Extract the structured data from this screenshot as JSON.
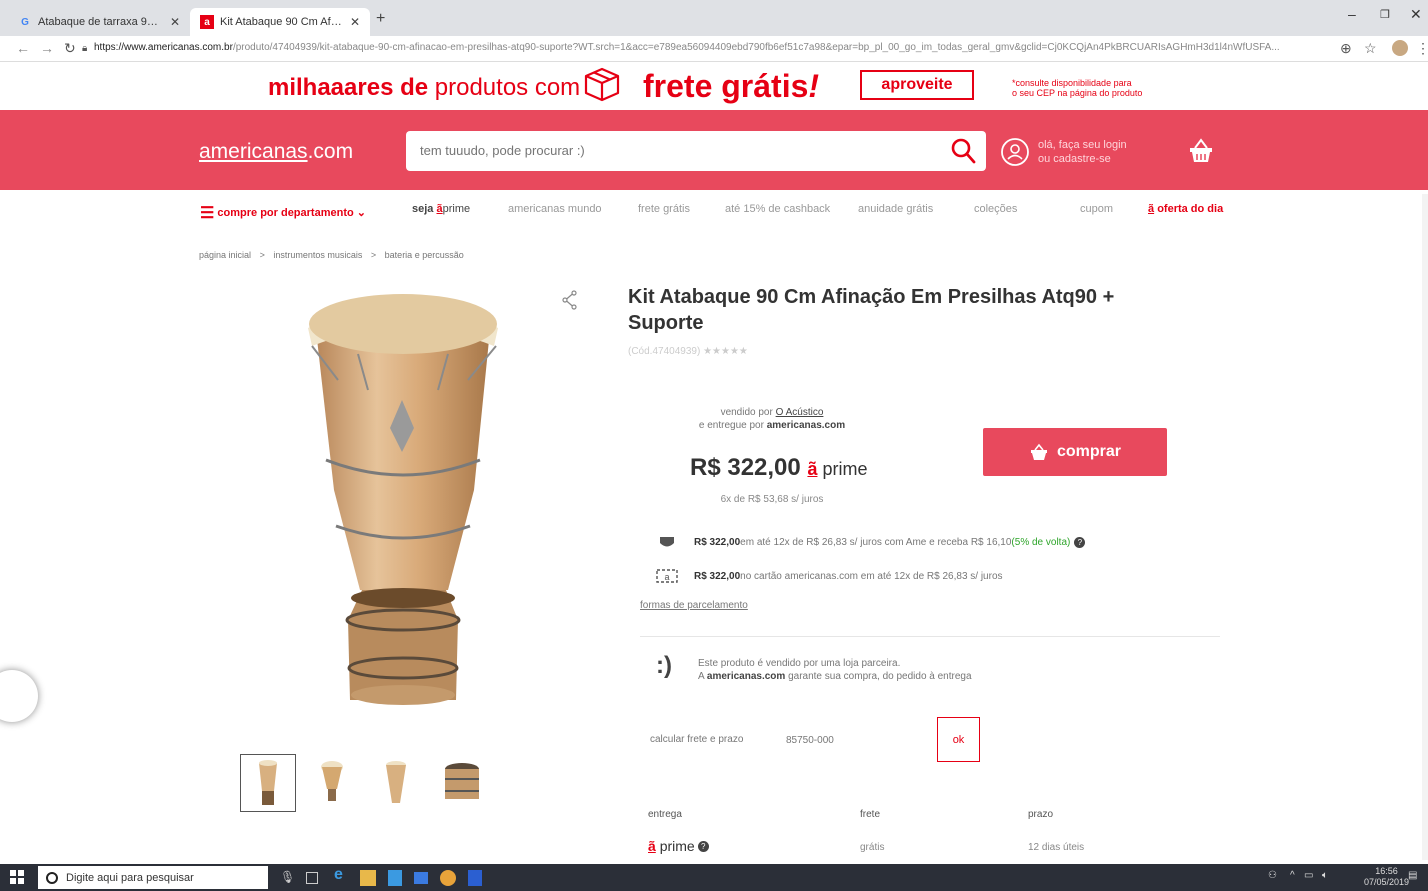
{
  "browser": {
    "tabs": [
      {
        "title": "Atabaque de tarraxa 90 cm - Pe",
        "favicon": "G"
      },
      {
        "title": "Kit Atabaque 90 Cm Afinação E",
        "favicon": "a"
      }
    ],
    "url_host": "https://www.americanas.com.br",
    "url_path": "/produto/47404939/kit-atabaque-90-cm-afinacao-em-presilhas-atq90-suporte?WT.srch=1&acc=e789ea56094409ebd790fb6ef51c7a98&epar=bp_pl_00_go_im_todas_geral_gmv&gclid=Cj0KCQjAn4PkBRCUARIsAGHmH3d1l4nWfUSFA..."
  },
  "promo": {
    "part1_bold": "milhaaares de",
    "part1_rest": " produtos com",
    "part2": "frete grátis",
    "part2_mark": "!",
    "button": "aproveite",
    "note_line1": "*consulte disponibilidade para",
    "note_line2": "o seu CEP na página do produto"
  },
  "header": {
    "logo_main": "americanas",
    "logo_suffix": ".com",
    "search_placeholder": "tem tuuudo, pode procurar :)",
    "login_line1": "olá, faça seu login",
    "login_line2": "ou cadastre-se"
  },
  "nav": {
    "department": "compre por departamento",
    "prime_pre": "seja",
    "prime_a": "ã",
    "prime": "prime",
    "links": [
      "americanas mundo",
      "frete grátis",
      "até 15% de cashback",
      "anuidade grátis",
      "coleções",
      "cupom"
    ],
    "offer": "oferta do dia"
  },
  "breadcrumb": [
    "página inicial",
    ">",
    "instrumentos musicais",
    ">",
    "bateria e percussão"
  ],
  "product": {
    "title": "Kit Atabaque 90 Cm Afinação Em Presilhas Atq90 + Suporte",
    "code": "(Cód.47404939)",
    "stars": "★★★★★",
    "sold_by_pre": "vendido por ",
    "seller": "O Acústico",
    "delivered_pre": "e entregue por ",
    "delivered_by": "americanas.com",
    "price": "R$ 322,00",
    "price_prime_a": "ã",
    "price_prime": "prime",
    "installments": "6x de R$ 53,68 s/ juros",
    "buy_button": "comprar",
    "ame_amount": "R$ 322,00",
    "ame_text": " em até 12x de R$ 26,83 s/ juros com Ame e receba R$ 16,10 ",
    "ame_cashback": "(5% de volta)",
    "card_amount": "R$ 322,00",
    "card_text": " no cartão americanas.com em até 12x de R$ 26,83 s/ juros",
    "payment_link": "formas de parcelamento",
    "partner_smile": ":)",
    "partner_line1": "Este produto é vendido por uma loja parceira.",
    "partner_line2_pre": "A ",
    "partner_brand": "americanas.com",
    "partner_line2_post": " garante sua compra, do pedido à entrega"
  },
  "shipping": {
    "label": "calcular frete e prazo",
    "cep": "85750-000",
    "ok": "ok",
    "headers": [
      "entrega",
      "frete",
      "prazo"
    ],
    "row": {
      "service_a": "ã",
      "service": "prime",
      "cost": "grátis",
      "time": "12 dias úteis"
    }
  },
  "taskbar": {
    "search": "Digite aqui para pesquisar",
    "time": "16:56",
    "date": "07/05/2019"
  },
  "colors": {
    "brand_red": "#e60014",
    "header_red": "#e8495d",
    "cashback_green": "#2fa52b"
  }
}
